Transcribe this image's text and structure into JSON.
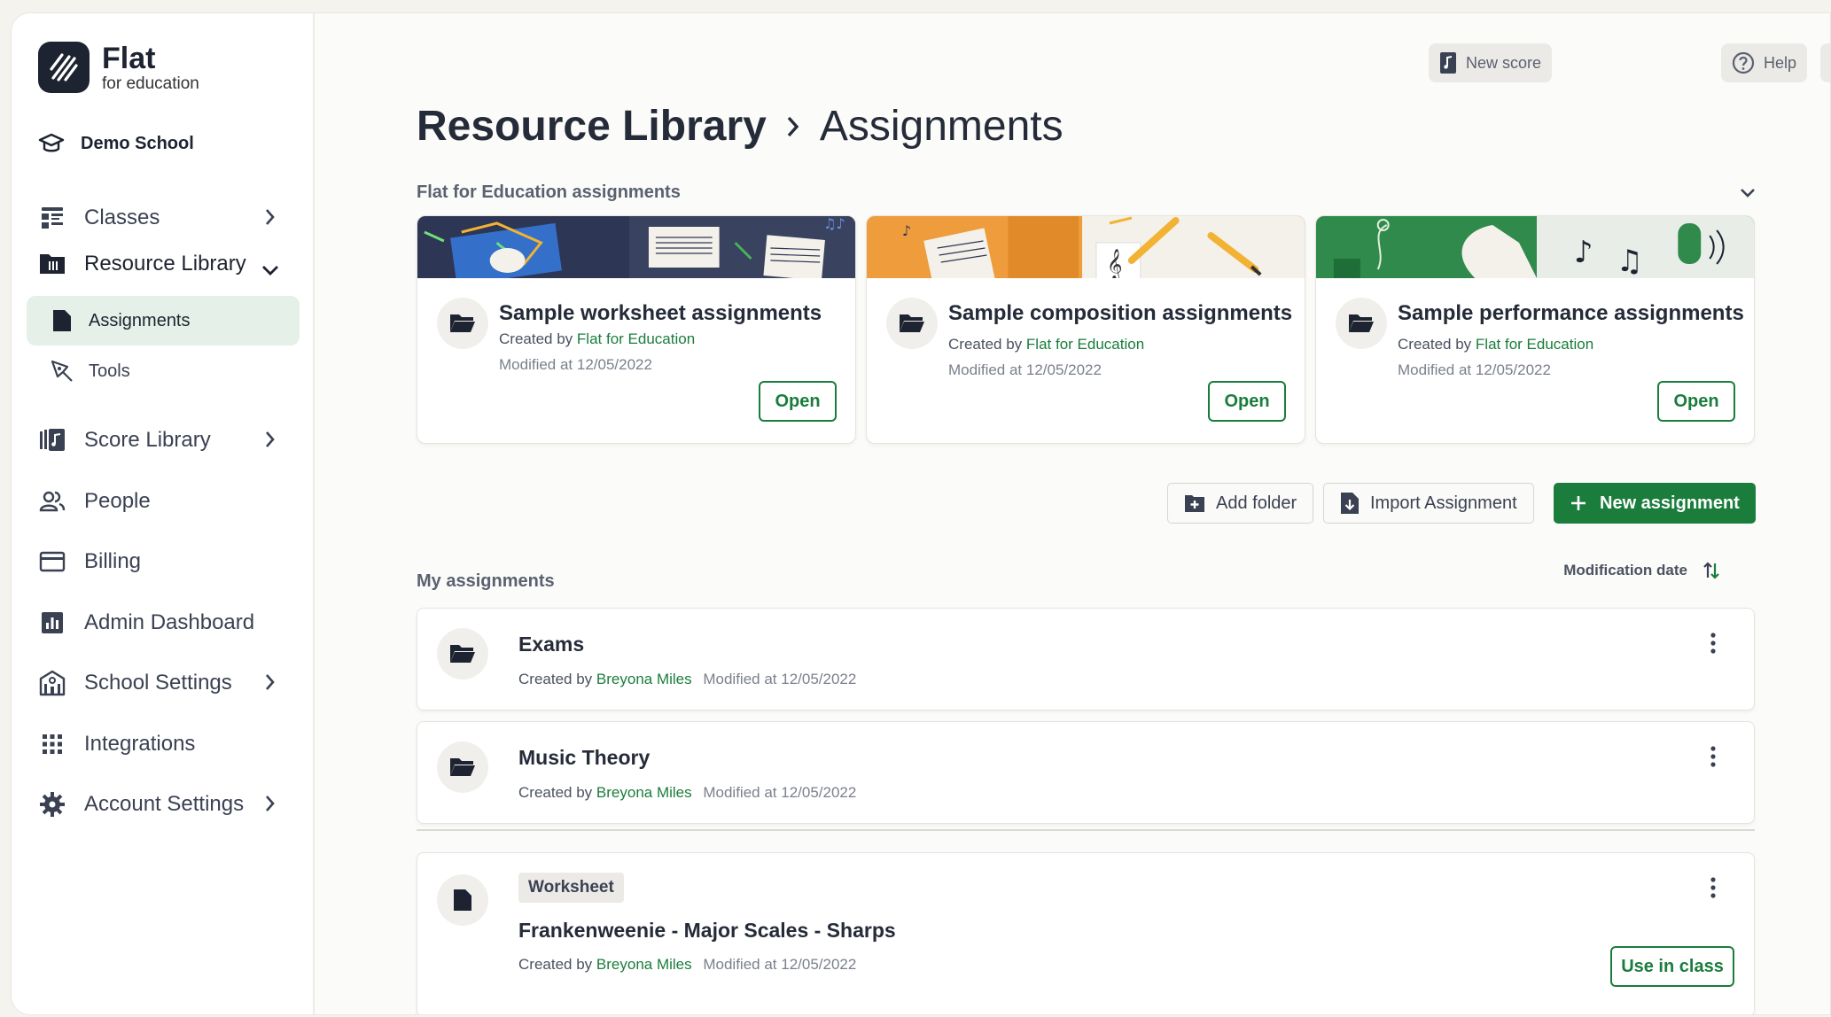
{
  "brand": {
    "title": "Flat",
    "subtitle": "for education"
  },
  "school": {
    "name": "Demo School"
  },
  "sidebar": {
    "items": [
      {
        "label": "Classes",
        "icon": "classes-icon"
      },
      {
        "label": "Resource Library",
        "icon": "library-icon"
      },
      {
        "label": "Assignments",
        "icon": "document-icon"
      },
      {
        "label": "Tools",
        "icon": "tools-icon"
      },
      {
        "label": "Score Library",
        "icon": "score-library-icon"
      },
      {
        "label": "People",
        "icon": "people-icon"
      },
      {
        "label": "Billing",
        "icon": "billing-icon"
      },
      {
        "label": "Admin Dashboard",
        "icon": "dashboard-icon"
      },
      {
        "label": "School Settings",
        "icon": "school-icon"
      },
      {
        "label": "Integrations",
        "icon": "grid-icon"
      },
      {
        "label": "Account Settings",
        "icon": "gear-icon"
      }
    ]
  },
  "topbar": {
    "new_score": "New score",
    "help": "Help"
  },
  "breadcrumb": {
    "parent": "Resource Library",
    "current": "Assignments"
  },
  "featured": {
    "label": "Flat for Education assignments",
    "created_by_prefix": "Created by",
    "cards": [
      {
        "title": "Sample worksheet assignments",
        "author": "Flat for Education",
        "modified": "Modified at 12/05/2022",
        "button": "Open"
      },
      {
        "title": "Sample composition assignments",
        "author": "Flat for Education",
        "modified": "Modified at 12/05/2022",
        "button": "Open"
      },
      {
        "title": "Sample performance assignments",
        "author": "Flat for Education",
        "modified": "Modified at 12/05/2022",
        "button": "Open"
      }
    ]
  },
  "actions": {
    "add_folder": "Add folder",
    "import": "Import Assignment",
    "new": "New assignment"
  },
  "my_assignments": {
    "label": "My assignments",
    "sort_label": "Modification date",
    "created_by_prefix": "Created by",
    "folders": [
      {
        "title": "Exams",
        "author": "Breyona Miles",
        "modified": "Modified at 12/05/2022"
      },
      {
        "title": "Music Theory",
        "author": "Breyona Miles",
        "modified": "Modified at 12/05/2022"
      }
    ],
    "items": [
      {
        "tag": "Worksheet",
        "title": "Frankenweenie - Major Scales - Sharps",
        "author": "Breyona Miles",
        "modified": "Modified at 12/05/2022",
        "button": "Use in class"
      }
    ]
  },
  "colors": {
    "accent": "#1a7d3c",
    "active_bg": "#e5f1e8",
    "dark": "#1d2330"
  }
}
